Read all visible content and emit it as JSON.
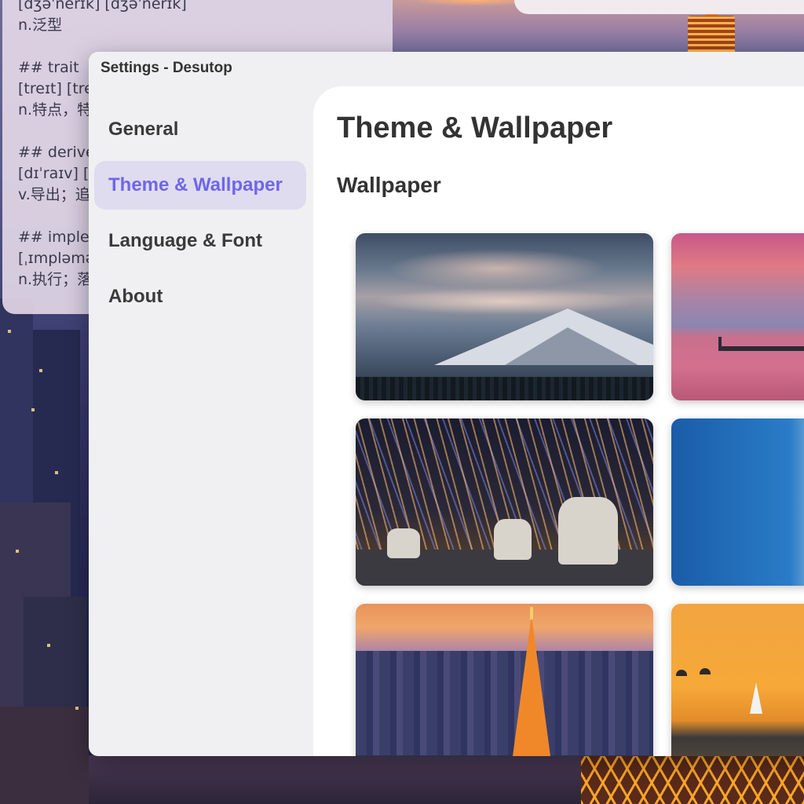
{
  "note_window": {
    "lines": [
      "[dʒəˈnerɪk] [dʒəˈnerɪk]",
      "n.泛型",
      "",
      "## trait",
      "[treɪt] [treɪt]",
      "n.特点，特征",
      "",
      "## derive",
      "[dɪˈraɪv] [dɪˈraɪv]",
      "v.导出；追溯",
      "",
      "## implement",
      "[ˌɪmpləmənt]",
      "n.执行；落实"
    ]
  },
  "settings": {
    "window_title": "Settings - Desutop",
    "nav": [
      {
        "label": "General",
        "active": false
      },
      {
        "label": "Theme & Wallpaper",
        "active": true
      },
      {
        "label": "Language & Font",
        "active": false
      },
      {
        "label": "About",
        "active": false
      }
    ],
    "page_title": "Theme & Wallpaper",
    "section_title": "Wallpaper",
    "wallpapers": [
      {
        "name": "mountain-wallpaper"
      },
      {
        "name": "pink-sunset-pier-wallpaper"
      },
      {
        "name": "star-trails-wallpaper"
      },
      {
        "name": "aerial-beach-wallpaper"
      },
      {
        "name": "tokyo-tower-wallpaper"
      },
      {
        "name": "orange-sea-kites-wallpaper"
      }
    ]
  },
  "colors": {
    "accent": "#7066e8",
    "active_nav_bg": "#dfdcf0",
    "window_bg": "#f0f0f2",
    "content_bg": "#ffffff"
  }
}
